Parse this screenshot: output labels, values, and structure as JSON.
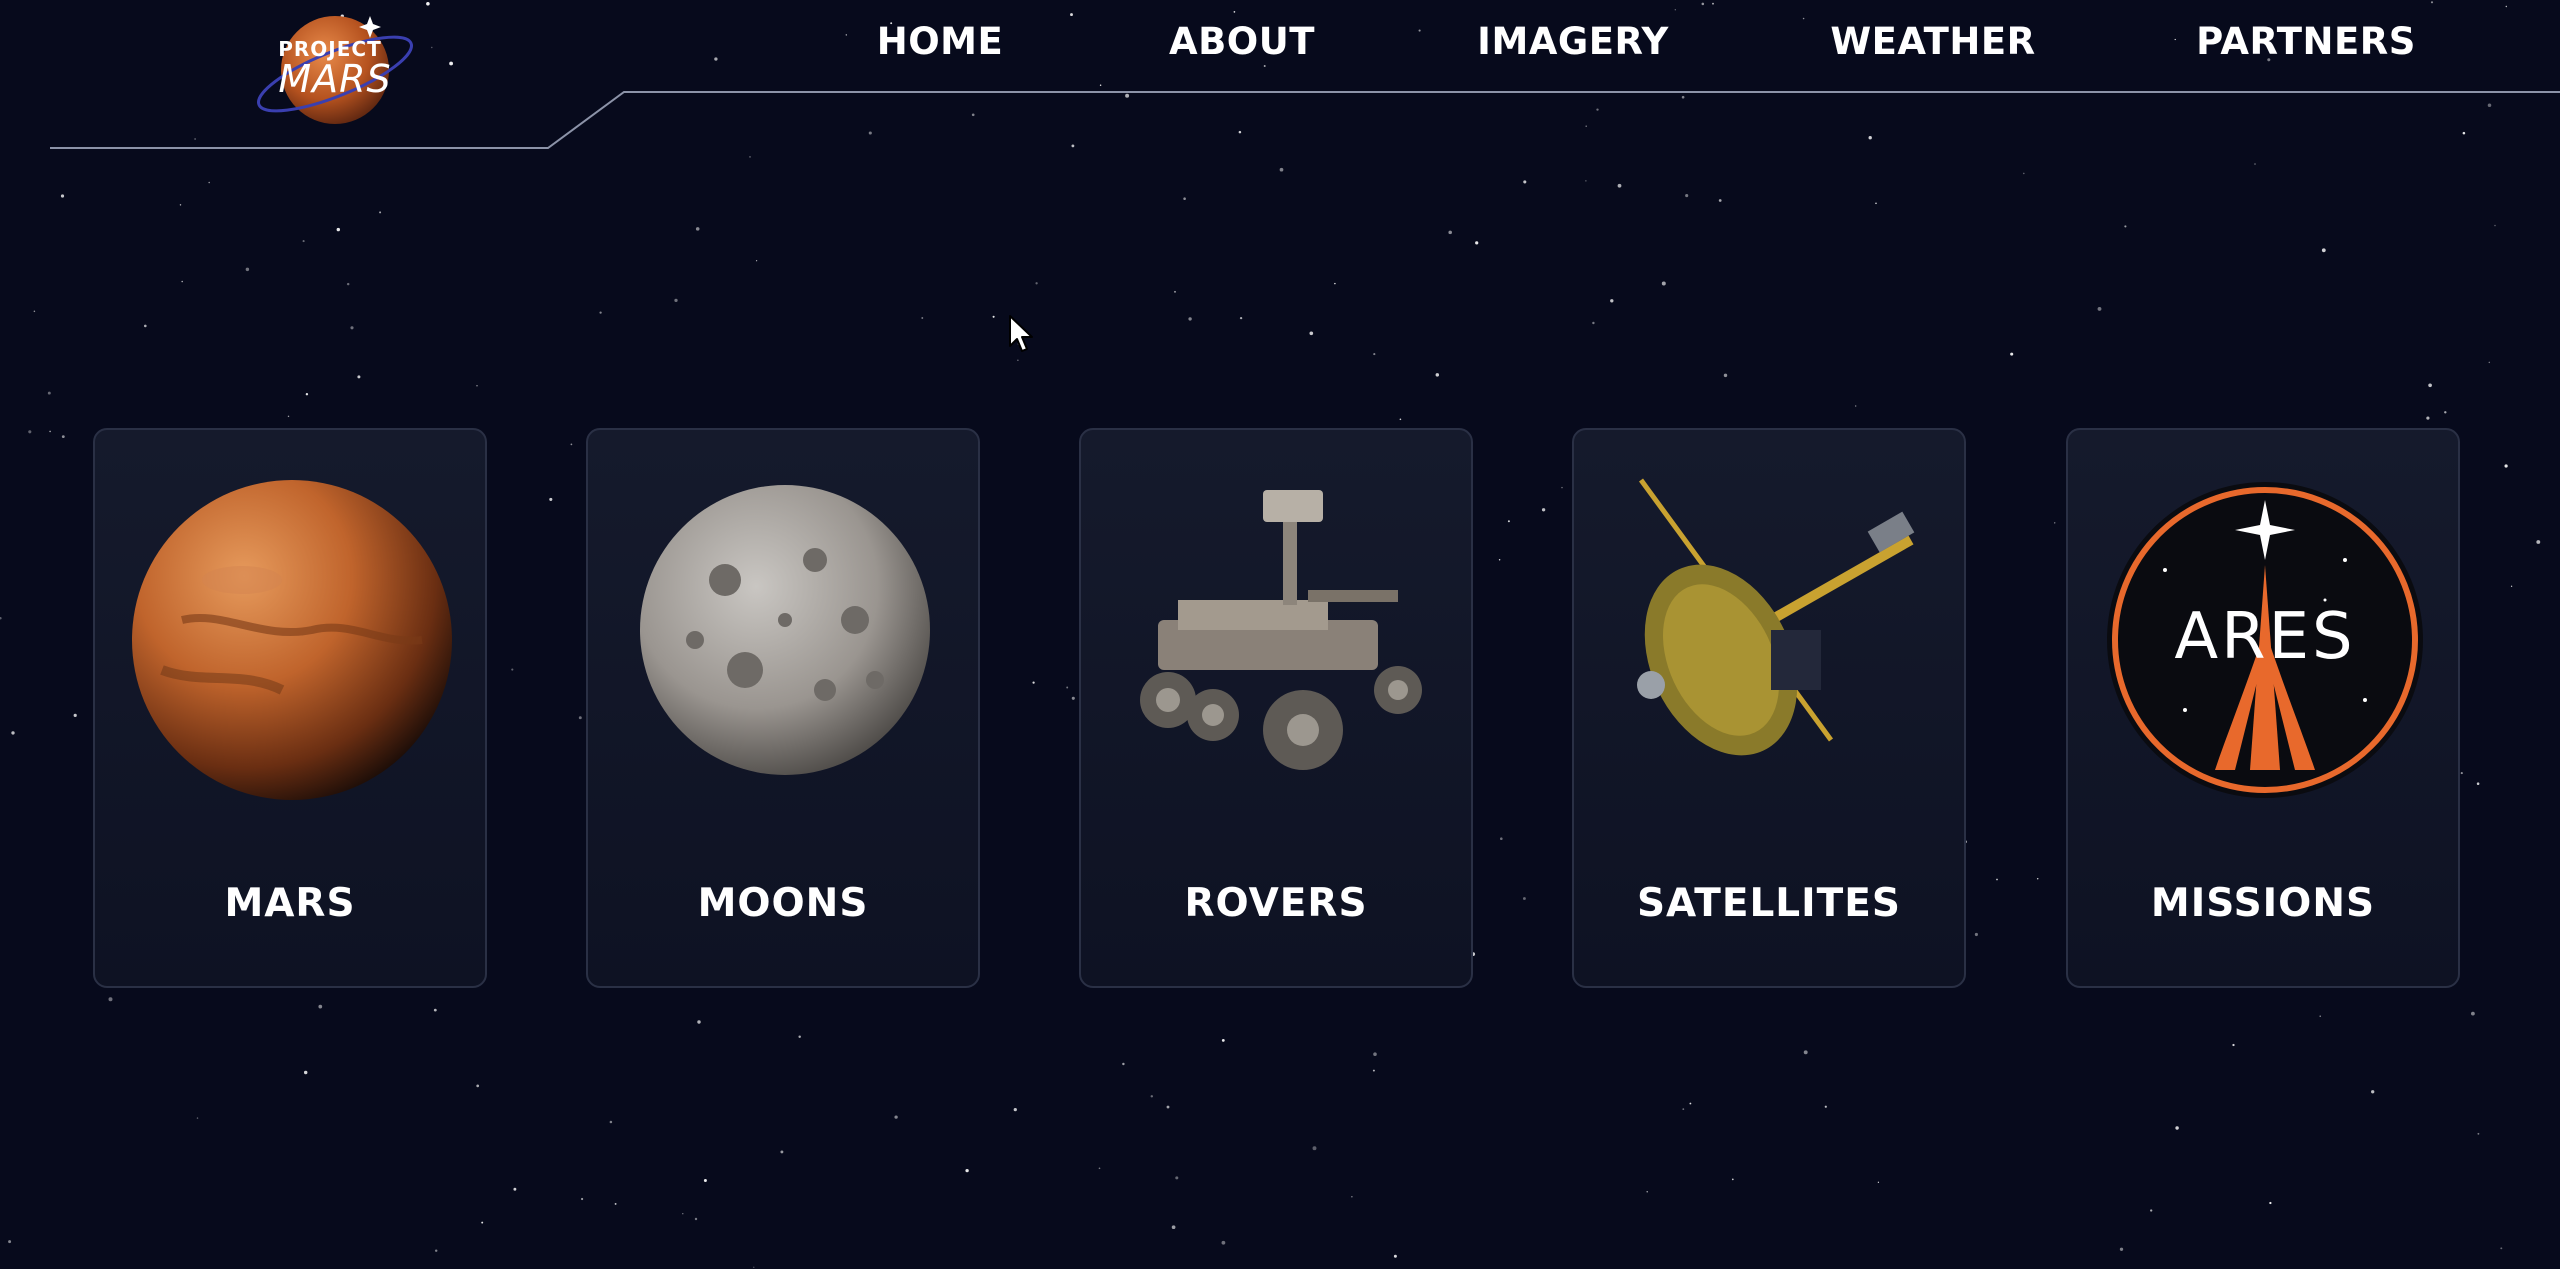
{
  "logo": {
    "line1": "PROJECT",
    "line2": "MARS"
  },
  "nav": [
    "HOME",
    "ABOUT",
    "IMAGERY",
    "WEATHER",
    "PARTNERS"
  ],
  "cards": [
    {
      "label": "MARS",
      "icon": "mars-planet-icon"
    },
    {
      "label": "MOONS",
      "icon": "moon-icon"
    },
    {
      "label": "ROVERS",
      "icon": "rover-icon"
    },
    {
      "label": "SATELLITES",
      "icon": "satellite-icon"
    },
    {
      "label": "MISSIONS",
      "icon": "ares-mission-badge-icon",
      "badge_text": "ARES"
    }
  ],
  "colors": {
    "background": "#070a1c",
    "card": "#141a2c",
    "mars_orange": "#c5622b",
    "badge_orange": "#e8692c"
  }
}
